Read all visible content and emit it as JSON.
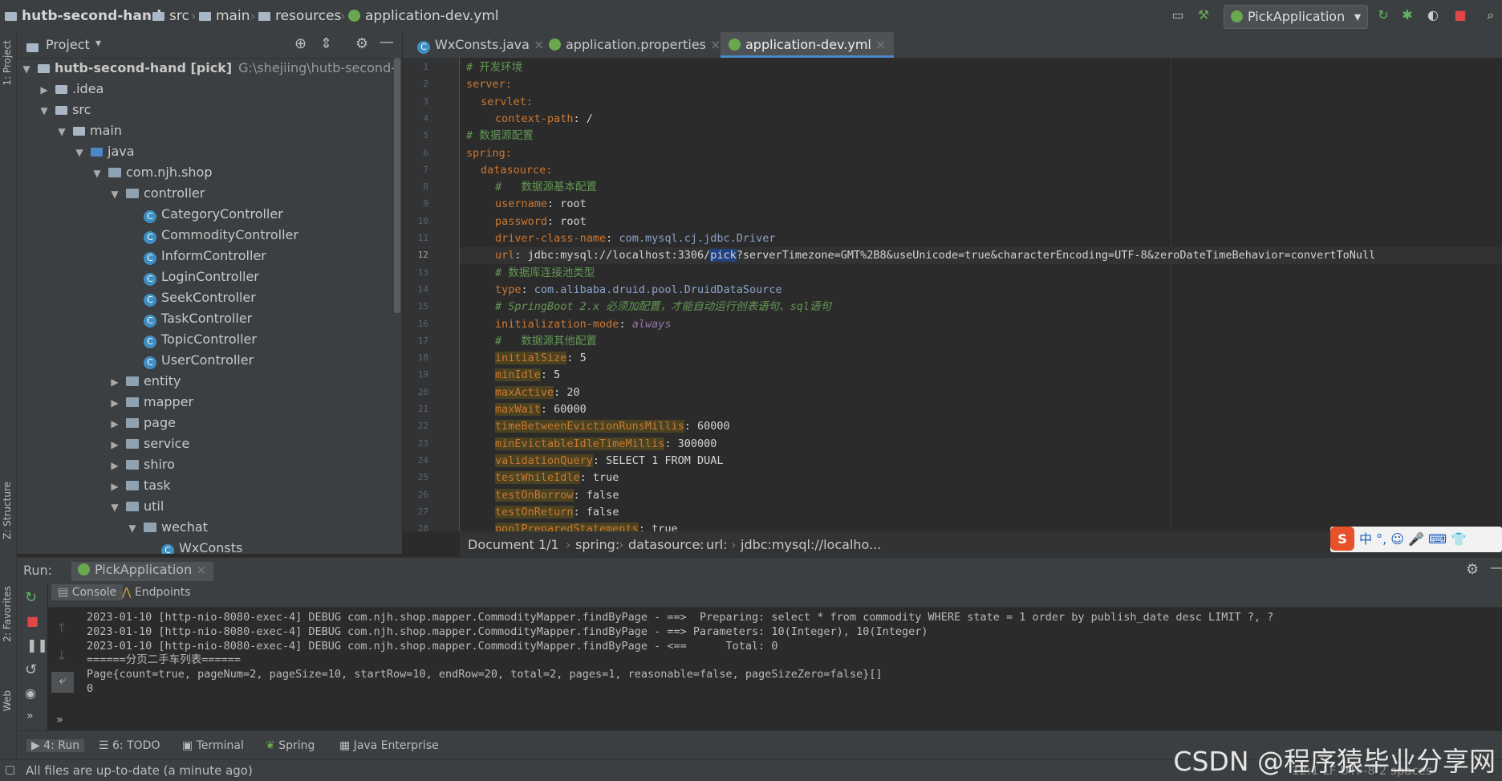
{
  "breadcrumb": [
    "hutb-second-hand",
    "src",
    "main",
    "resources",
    "application-dev.yml"
  ],
  "run_config": "PickApplication",
  "project_panel": {
    "title": "Project",
    "tree": [
      {
        "label": "hutb-second-hand [pick]",
        "extra": "G:\\shejiing\\hutb-second-hand",
        "indent": 0,
        "arrow": "▼",
        "kind": "module"
      },
      {
        "label": ".idea",
        "indent": 1,
        "arrow": "▶",
        "kind": "folder"
      },
      {
        "label": "src",
        "indent": 1,
        "arrow": "▼",
        "kind": "folder"
      },
      {
        "label": "main",
        "indent": 2,
        "arrow": "▼",
        "kind": "folder"
      },
      {
        "label": "java",
        "indent": 3,
        "arrow": "▼",
        "kind": "srcfolder"
      },
      {
        "label": "com.njh.shop",
        "indent": 4,
        "arrow": "▼",
        "kind": "package"
      },
      {
        "label": "controller",
        "indent": 5,
        "arrow": "▼",
        "kind": "package"
      },
      {
        "label": "CategoryController",
        "indent": 6,
        "arrow": "",
        "kind": "class"
      },
      {
        "label": "CommodityController",
        "indent": 6,
        "arrow": "",
        "kind": "class"
      },
      {
        "label": "InformController",
        "indent": 6,
        "arrow": "",
        "kind": "class"
      },
      {
        "label": "LoginController",
        "indent": 6,
        "arrow": "",
        "kind": "class"
      },
      {
        "label": "SeekController",
        "indent": 6,
        "arrow": "",
        "kind": "class"
      },
      {
        "label": "TaskController",
        "indent": 6,
        "arrow": "",
        "kind": "class"
      },
      {
        "label": "TopicController",
        "indent": 6,
        "arrow": "",
        "kind": "class"
      },
      {
        "label": "UserController",
        "indent": 6,
        "arrow": "",
        "kind": "class"
      },
      {
        "label": "entity",
        "indent": 5,
        "arrow": "▶",
        "kind": "package"
      },
      {
        "label": "mapper",
        "indent": 5,
        "arrow": "▶",
        "kind": "package"
      },
      {
        "label": "page",
        "indent": 5,
        "arrow": "▶",
        "kind": "package"
      },
      {
        "label": "service",
        "indent": 5,
        "arrow": "▶",
        "kind": "package"
      },
      {
        "label": "shiro",
        "indent": 5,
        "arrow": "▶",
        "kind": "package"
      },
      {
        "label": "task",
        "indent": 5,
        "arrow": "▶",
        "kind": "package"
      },
      {
        "label": "util",
        "indent": 5,
        "arrow": "▼",
        "kind": "package"
      },
      {
        "label": "wechat",
        "indent": 6,
        "arrow": "▼",
        "kind": "package"
      },
      {
        "label": "WxConsts",
        "indent": 7,
        "arrow": "",
        "kind": "class"
      }
    ]
  },
  "editor_tabs": [
    "WxConsts.java",
    "application.properties",
    "application-dev.yml"
  ],
  "code_lines": [
    {
      "n": "1",
      "t": "# 开发环境",
      "c": "cm",
      "i": 0
    },
    {
      "n": "2",
      "t": "server:",
      "c": "k",
      "i": 0
    },
    {
      "n": "3",
      "t": "servlet:",
      "c": "k",
      "i": 1
    },
    {
      "n": "4",
      "t": "context-path",
      "v": ": /",
      "c": "k",
      "i": 2
    },
    {
      "n": "5",
      "t": "# 数据源配置",
      "c": "cm",
      "i": 0
    },
    {
      "n": "6",
      "t": "spring:",
      "c": "k",
      "i": 0
    },
    {
      "n": "7",
      "t": "datasource:",
      "c": "k",
      "i": 1
    },
    {
      "n": "8",
      "t": "#   数据源基本配置",
      "c": "cm",
      "i": 2
    },
    {
      "n": "9",
      "t": "username",
      "v": ": root",
      "c": "k",
      "i": 2
    },
    {
      "n": "10",
      "t": "password",
      "v": ": root",
      "c": "k",
      "i": 2
    },
    {
      "n": "11",
      "t": "driver-class-name",
      "v": ": ",
      "cls": "com.mysql.cj.jdbc.Driver",
      "c": "k",
      "i": 2
    },
    {
      "n": "12",
      "t": "url",
      "v": ": jdbc:mysql://localhost:3306/",
      "sel": "pick",
      "v2": "?serverTimezone=GMT%2B8&useUnicode=true&characterEncoding=UTF-8&zeroDateTimeBehavior=convertToNull",
      "c": "k",
      "i": 2,
      "current": true
    },
    {
      "n": "13",
      "t": "# 数据库连接池类型",
      "c": "cm",
      "i": 2
    },
    {
      "n": "14",
      "t": "type",
      "v": ": ",
      "cls": "com.alibaba.druid.pool.DruidDataSource",
      "c": "k",
      "i": 2
    },
    {
      "n": "15",
      "t": "# SpringBoot 2.x 必须加配置，才能自动运行创表语句、sql语句",
      "c": "cmi",
      "i": 2
    },
    {
      "n": "16",
      "t": "initialization-mode",
      "v": ": ",
      "itv": "always",
      "c": "k",
      "i": 2
    },
    {
      "n": "17",
      "t": "#   数据源其他配置",
      "c": "cm",
      "i": 2
    },
    {
      "n": "18",
      "t": "initialSize",
      "v": ": 5",
      "c": "hl",
      "i": 2
    },
    {
      "n": "19",
      "t": "minIdle",
      "v": ": 5",
      "c": "hl",
      "i": 2
    },
    {
      "n": "20",
      "t": "maxActive",
      "v": ": 20",
      "c": "hl",
      "i": 2
    },
    {
      "n": "21",
      "t": "maxWait",
      "v": ": 60000",
      "c": "hl",
      "i": 2
    },
    {
      "n": "22",
      "t": "timeBetweenEvictionRunsMillis",
      "v": ": 60000",
      "c": "hl",
      "i": 2
    },
    {
      "n": "23",
      "t": "minEvictableIdleTimeMillis",
      "v": ": 300000",
      "c": "hl",
      "i": 2
    },
    {
      "n": "24",
      "t": "validationQuery",
      "v": ": SELECT 1 FROM DUAL",
      "c": "hl",
      "i": 2
    },
    {
      "n": "25",
      "t": "testWhileIdle",
      "v": ": true",
      "c": "hl",
      "i": 2
    },
    {
      "n": "26",
      "t": "testOnBorrow",
      "v": ": false",
      "c": "hl",
      "i": 2
    },
    {
      "n": "27",
      "t": "testOnReturn",
      "v": ": false",
      "c": "hl",
      "i": 2
    },
    {
      "n": "28",
      "t": "poolPreparedStatements",
      "v": ": true",
      "c": "hl",
      "i": 2
    }
  ],
  "editor_breadcrumb": [
    "Document 1/1",
    "spring:",
    "datasource:",
    "url:",
    "jdbc:mysql://localho..."
  ],
  "run_panel": {
    "label": "Run:",
    "tab": "PickApplication",
    "sub_tabs": [
      "Console",
      "Endpoints"
    ]
  },
  "console_lines": [
    "2023-01-10 [http-nio-8080-exec-4] DEBUG com.njh.shop.mapper.CommodityMapper.findByPage - ==>  Preparing: select * from commodity WHERE state = 1 order by publish_date desc LIMIT ?, ?",
    "2023-01-10 [http-nio-8080-exec-4] DEBUG com.njh.shop.mapper.CommodityMapper.findByPage - ==> Parameters: 10(Integer), 10(Integer)",
    "2023-01-10 [http-nio-8080-exec-4] DEBUG com.njh.shop.mapper.CommodityMapper.findByPage - <==      Total: 0",
    "======分页二手车列表======",
    "Page{count=true, pageNum=2, pageSize=10, startRow=10, endRow=20, total=2, pages=1, reasonable=false, pageSizeZero=false}[]",
    "0"
  ],
  "bottom_tabs": [
    "4: Run",
    "6: TODO",
    "Terminal",
    "Spring",
    "Java Enterprise"
  ],
  "left_strip_labels": [
    "1: Project",
    "Z: Structure",
    "2: Favorites",
    "Web"
  ],
  "status": {
    "message": "All files are up-to-date (a minute ago)",
    "right": "12:1  LF  UTF-8  2 spaces"
  },
  "watermark": "CSDN @程序猿毕业分享网",
  "ime_bar": "中 °, ☺ 🎤 ⌨ 👕",
  "colors": {
    "accent": "#4a88c7",
    "bg": "#2b2b2b",
    "panel": "#3c3f41",
    "keyword": "#cc7832",
    "comment": "#629755"
  }
}
